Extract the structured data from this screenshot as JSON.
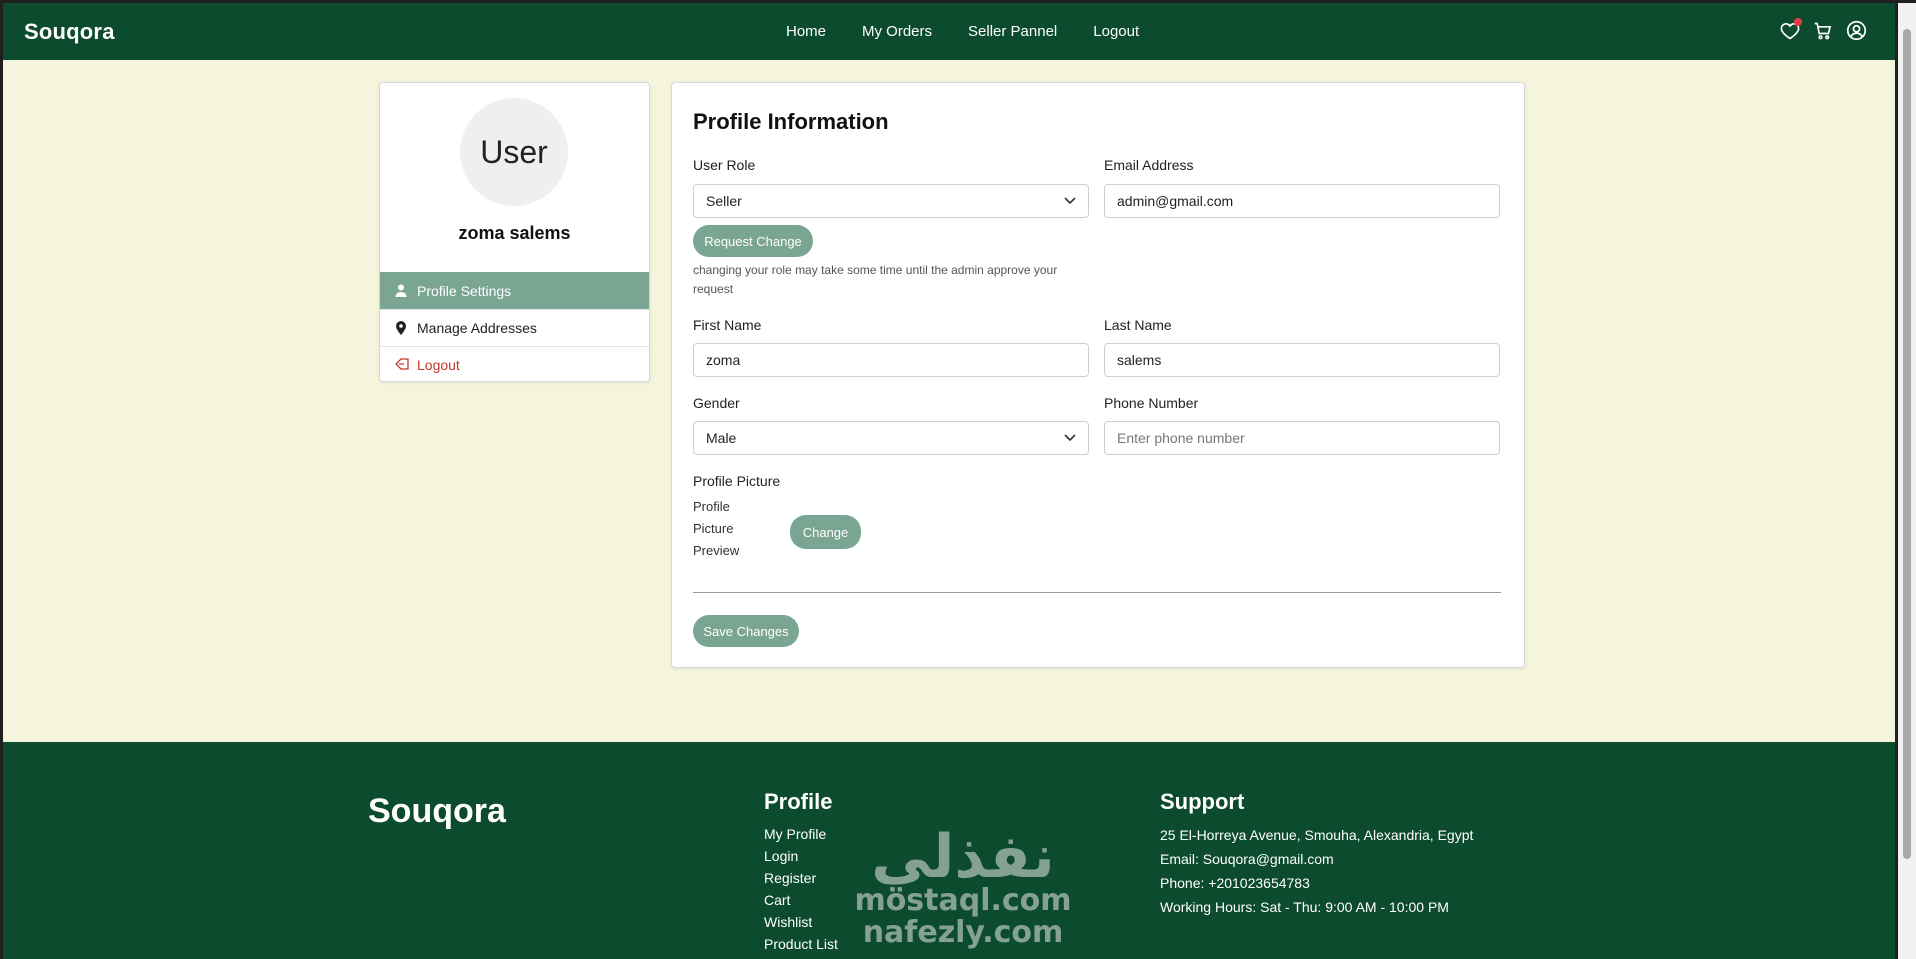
{
  "nav": {
    "brand": "Souqora",
    "links": [
      "Home",
      "My Orders",
      "Seller Pannel",
      "Logout"
    ],
    "icons": [
      "heart-icon",
      "cart-icon",
      "user-circle-icon"
    ],
    "colors": {
      "bar": "#0c4b2e",
      "accent": "#7ba593",
      "page_bg": "#f5f4dd"
    }
  },
  "sidebar": {
    "avatar_text": "User",
    "user_name": "zoma salems",
    "menu": [
      {
        "label": "Profile Settings",
        "icon": "user-icon",
        "active": true
      },
      {
        "label": "Manage Addresses",
        "icon": "map-pin-icon",
        "active": false
      },
      {
        "label": "Logout",
        "icon": "logout-icon",
        "active": false
      }
    ]
  },
  "profile": {
    "title": "Profile Information",
    "user_role": {
      "label": "User Role",
      "value": "Seller"
    },
    "email": {
      "label": "Email Address",
      "value": "admin@gmail.com"
    },
    "request_change_label": "Request Change",
    "role_hint": "changing your role may take some time until the admin approve your request",
    "first_name": {
      "label": "First Name",
      "value": "zoma"
    },
    "last_name": {
      "label": "Last Name",
      "value": "salems"
    },
    "gender": {
      "label": "Gender",
      "value": "Male"
    },
    "phone": {
      "label": "Phone Number",
      "value": "",
      "placeholder": "Enter phone number"
    },
    "picture": {
      "label": "Profile Picture",
      "alt_text": "Profile Picture Preview",
      "change_label": "Change"
    },
    "save_label": "Save Changes"
  },
  "footer": {
    "brand": "Souqora",
    "profile": {
      "heading": "Profile",
      "links": [
        "My Profile",
        "Login",
        "Register",
        "Cart",
        "Wishlist",
        "Product List"
      ]
    },
    "support": {
      "heading": "Support",
      "lines": [
        "25 El-Horreya Avenue, Smouha, Alexandria, Egypt",
        "Email: Souqora@gmail.com",
        "Phone: +201023654783",
        "Working Hours: Sat - Thu: 9:00 AM - 10:00 PM"
      ]
    },
    "watermark": {
      "arabic": "نفذلي",
      "lines": [
        "mostaql.com",
        "nafezly.com"
      ]
    }
  }
}
